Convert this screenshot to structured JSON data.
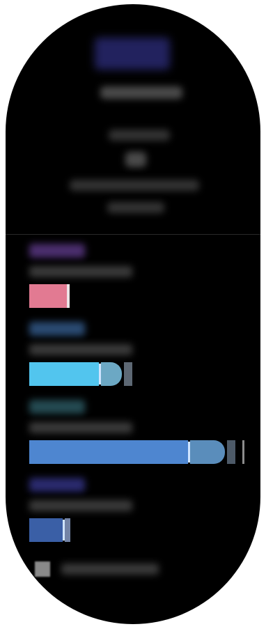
{
  "screen": {
    "header": {
      "time_badge": "",
      "title": "",
      "subtitle": "",
      "value": "",
      "detail_1": "",
      "detail_2": ""
    },
    "stages": [
      {
        "label": "",
        "sub": "",
        "color": "#e27a92",
        "label_color": "#4b2e6e",
        "level": 0.18
      },
      {
        "label": "",
        "sub": "",
        "color": "#52c5ee",
        "label_color": "#2a4a72",
        "level": 0.45
      },
      {
        "label": "",
        "sub": "",
        "color": "#4e86d0",
        "label_color": "#244a52",
        "level": 0.92
      },
      {
        "label": "",
        "sub": "",
        "color": "#3a5fa6",
        "label_color": "#2a2a6e",
        "level": 0.2
      }
    ],
    "legend": {
      "label": "",
      "swatch_color": "#8a8a8a"
    }
  }
}
